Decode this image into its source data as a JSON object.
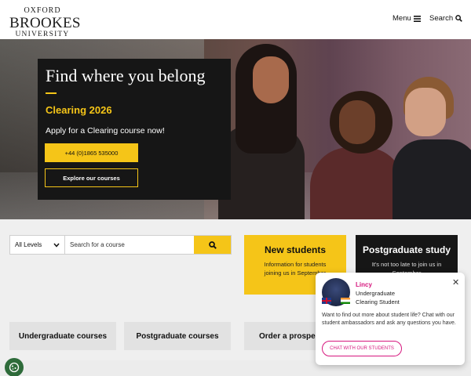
{
  "header": {
    "logo": {
      "line1": "OXFORD",
      "line2": "BROOKES",
      "line3": "UNIVERSITY"
    },
    "menu_label": "Menu",
    "search_label": "Search"
  },
  "hero": {
    "title": "Find where you belong",
    "subtitle": "Clearing 2026",
    "text": "Apply for a Clearing course now!",
    "phone_button": "+44 (0)1865 535000",
    "explore_button": "Explore our courses"
  },
  "course_search": {
    "level_selected": "All Levels",
    "placeholder": "Search for a course"
  },
  "cards": {
    "new_students": {
      "title": "New students",
      "desc": "Information for students joining us in September"
    },
    "postgraduate": {
      "title": "Postgraduate study",
      "desc": "It's not too late to join us in September"
    }
  },
  "links": {
    "undergraduate": "Undergraduate courses",
    "postgraduate": "Postgraduate courses",
    "prospectus": "Order a prospectus"
  },
  "chat": {
    "name": "Lincy",
    "role": "Undergraduate",
    "role2": "Clearing Student",
    "message": "Want to find out more about student life? Chat with our student ambassadors and ask any questions you have.",
    "button": "CHAT WITH OUR STUDENTS"
  },
  "colors": {
    "accent": "#f5c518",
    "dark": "#161616",
    "chat_accent": "#d6177e",
    "cookie": "#2e6b3a"
  }
}
